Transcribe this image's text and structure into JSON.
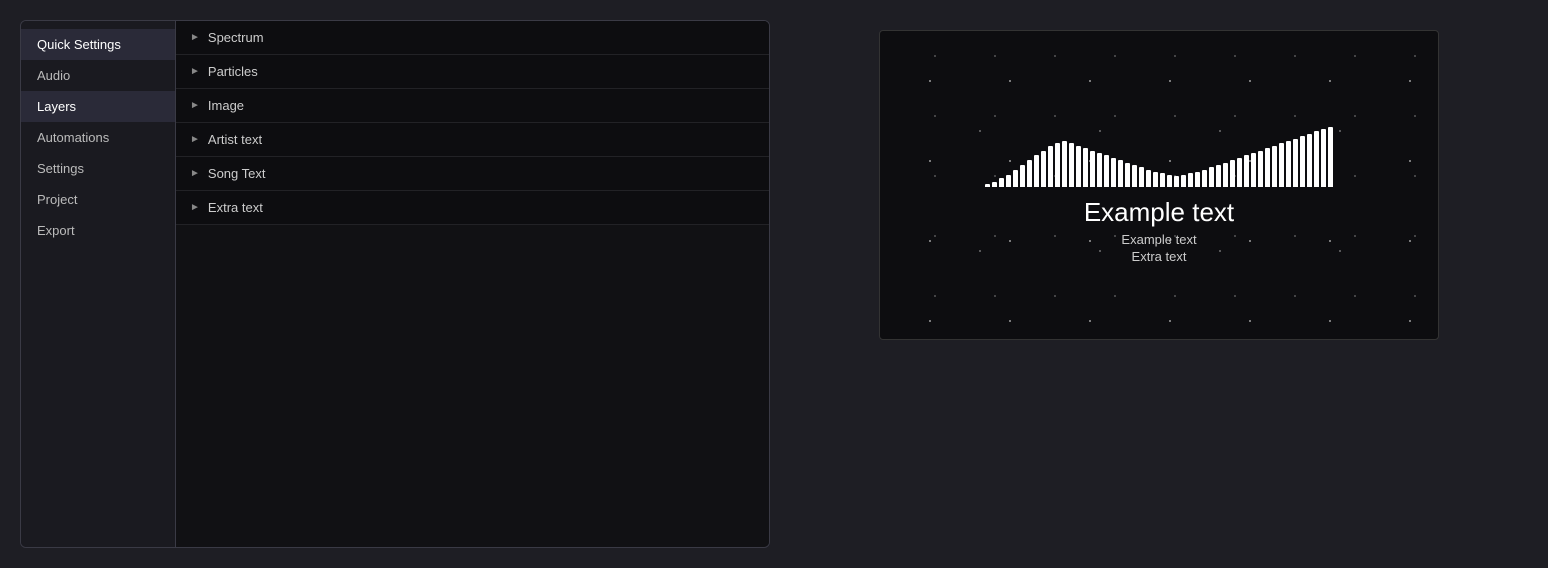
{
  "sidebar": {
    "items": [
      {
        "id": "quick-settings",
        "label": "Quick Settings",
        "active": true
      },
      {
        "id": "audio",
        "label": "Audio",
        "active": false
      },
      {
        "id": "layers",
        "label": "Layers",
        "active": true
      },
      {
        "id": "automations",
        "label": "Automations",
        "active": false
      },
      {
        "id": "settings",
        "label": "Settings",
        "active": false
      },
      {
        "id": "project",
        "label": "Project",
        "active": false
      },
      {
        "id": "export",
        "label": "Export",
        "active": false
      }
    ]
  },
  "layers": {
    "items": [
      {
        "id": "spectrum",
        "label": "Spectrum"
      },
      {
        "id": "particles",
        "label": "Particles"
      },
      {
        "id": "image",
        "label": "Image"
      },
      {
        "id": "artist-text",
        "label": "Artist text"
      },
      {
        "id": "song-text",
        "label": "Song Text"
      },
      {
        "id": "extra-text",
        "label": "Extra text"
      }
    ]
  },
  "preview": {
    "main_text": "Example text",
    "sub_text": "Example text",
    "extra_text": "Extra text"
  },
  "spectrum": {
    "bars": [
      2,
      4,
      7,
      10,
      14,
      18,
      22,
      26,
      30,
      34,
      36,
      38,
      36,
      34,
      32,
      30,
      28,
      26,
      24,
      22,
      20,
      18,
      16,
      14,
      12,
      11,
      10,
      9,
      10,
      11,
      12,
      14,
      16,
      18,
      20,
      22,
      24,
      26,
      28,
      30,
      32,
      34,
      36,
      38,
      40,
      42,
      44,
      46,
      48,
      50
    ]
  }
}
